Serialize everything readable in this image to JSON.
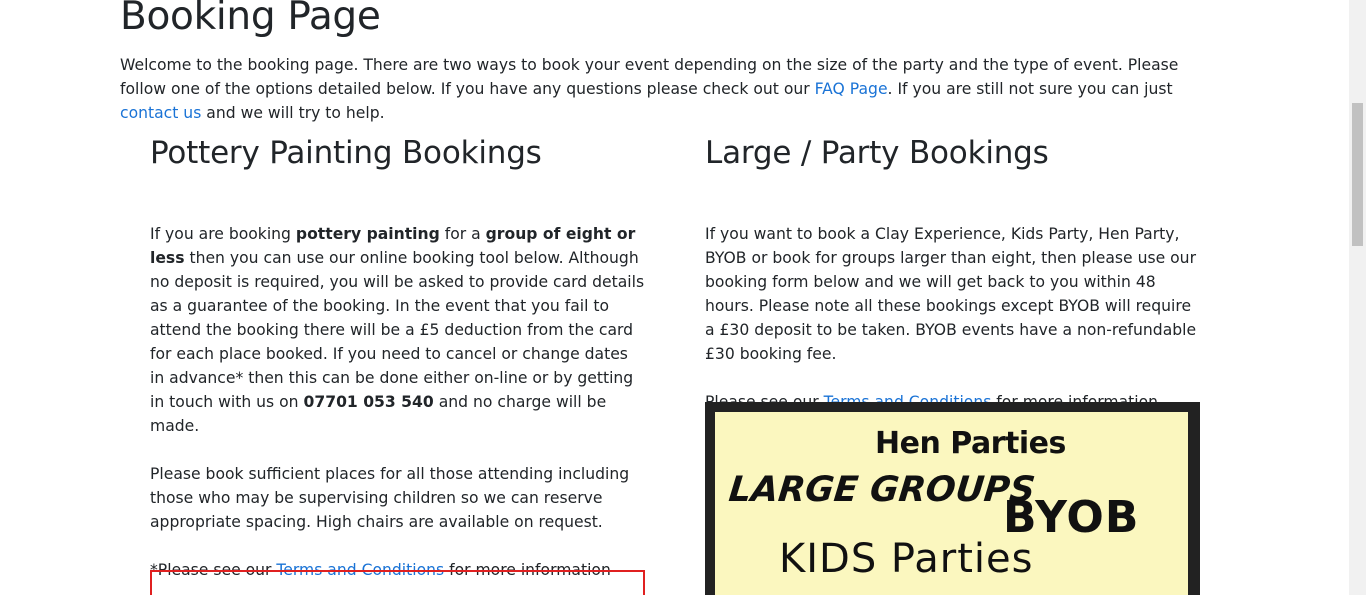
{
  "page": {
    "title": "Booking Page",
    "intro_before_faq": "Welcome to the booking page. There are two ways to book your event depending on the size of the party and the type of event. Please follow one of the options detailed below. If you have any questions please check out our ",
    "faq_link": "FAQ Page",
    "intro_between": ". If you are still not sure you can just ",
    "contact_link": "contact us",
    "intro_after": " and we will try to help."
  },
  "pottery": {
    "heading": "Pottery Painting Bookings",
    "p1_a": "If you are booking ",
    "p1_b_bold": "pottery painting",
    "p1_c": " for a ",
    "p1_d_bold": "group of eight or less",
    "p1_e": " then you can use our online booking tool below. Although no deposit is required, you will be asked to provide card details as a guarantee of the booking. In the event that you fail to attend the booking there will be a £5 deduction from the card for each place booked. If you need to cancel or change dates in advance* then this can be done either on-line or by getting in touch with us on ",
    "p1_phone_bold": "07701 053 540",
    "p1_f": " and no charge will be made.",
    "p2": "Please book sufficient places for all those attending including those who may be supervising children so we can reserve appropriate spacing. High chairs are available on request.",
    "p3_a": "*Please see our ",
    "p3_link": "Terms and Conditions",
    "p3_b": " for more information"
  },
  "large": {
    "heading": "Large / Party Bookings",
    "p1": "If you want to book a Clay Experience, Kids Party, Hen Party, BYOB or book for groups larger than eight, then please use our booking form below and we will get back to you within 48 hours. Please note all these bookings except BYOB will require a £30 deposit to be taken. BYOB events have a non-refundable £30 booking fee.",
    "p2_a": "Please see our ",
    "p2_link": "Terms and Conditions",
    "p2_b": " for more information",
    "poster": {
      "line1": "Hen Parties",
      "line2": "LARGE GROUPS",
      "line3": "BYOB",
      "line4": "KIDS Parties"
    }
  },
  "colors": {
    "link": "#1a73d6",
    "frame_border": "#e02020",
    "poster_bg": "#fbf7bf",
    "poster_border": "#222222"
  }
}
